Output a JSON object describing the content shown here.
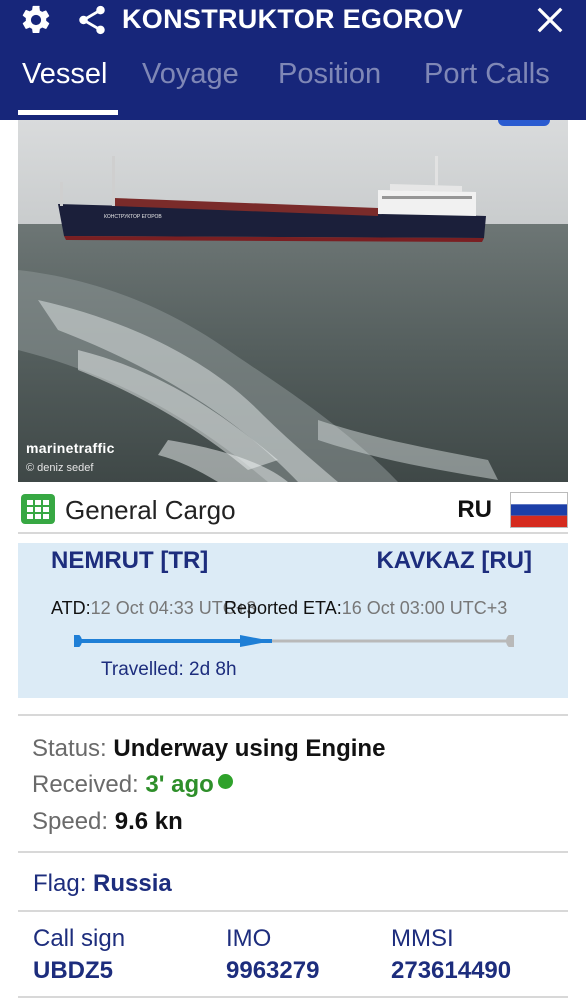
{
  "app": {
    "vessel_name": "KONSTRUKTOR EGOROV",
    "icons": {
      "settings": "gear-icon",
      "share": "share-icon",
      "close": "close-icon"
    },
    "colors": {
      "header": "#17267a",
      "accent_green": "#2e8f2a",
      "navy_text": "#1d2d7d",
      "voyage_panel": "#dcebf6",
      "progress": "#1f7fd6"
    }
  },
  "tabs": [
    {
      "label": "Vessel",
      "active": true
    },
    {
      "label": "Voyage",
      "active": false
    },
    {
      "label": "Position",
      "active": false
    },
    {
      "label": "Port Calls",
      "active": false
    }
  ],
  "photo": {
    "watermark": "marinetraffic",
    "credit": "© deniz sedef",
    "hull_text": "КОНСТРУКТОР ЕГОРОВ"
  },
  "vessel_type": {
    "label": "General Cargo",
    "icon": "grid-icon",
    "flag_code": "RU"
  },
  "voyage": {
    "origin": "NEMRUT [TR]",
    "destination": "KAVKAZ [RU]",
    "atd_label": "ATD:",
    "atd_value": "12 Oct 04:33 UTC+3",
    "eta_label": "Reported ETA:",
    "eta_value": "16 Oct 03:00 UTC+3",
    "travelled": "Travelled: 2d 8h",
    "progress": 0.45
  },
  "status": {
    "status_label": "Status:",
    "status_value": "Underway using Engine",
    "received_label": "Received:",
    "received_value": "3' ago",
    "speed_label": "Speed:",
    "speed_value": "9.6 kn"
  },
  "flag": {
    "label": "Flag:",
    "value": "Russia"
  },
  "identifiers": [
    {
      "label": "Call sign",
      "value": "UBDZ5"
    },
    {
      "label": "IMO",
      "value": "9963279"
    },
    {
      "label": "MMSI",
      "value": "273614490"
    }
  ]
}
